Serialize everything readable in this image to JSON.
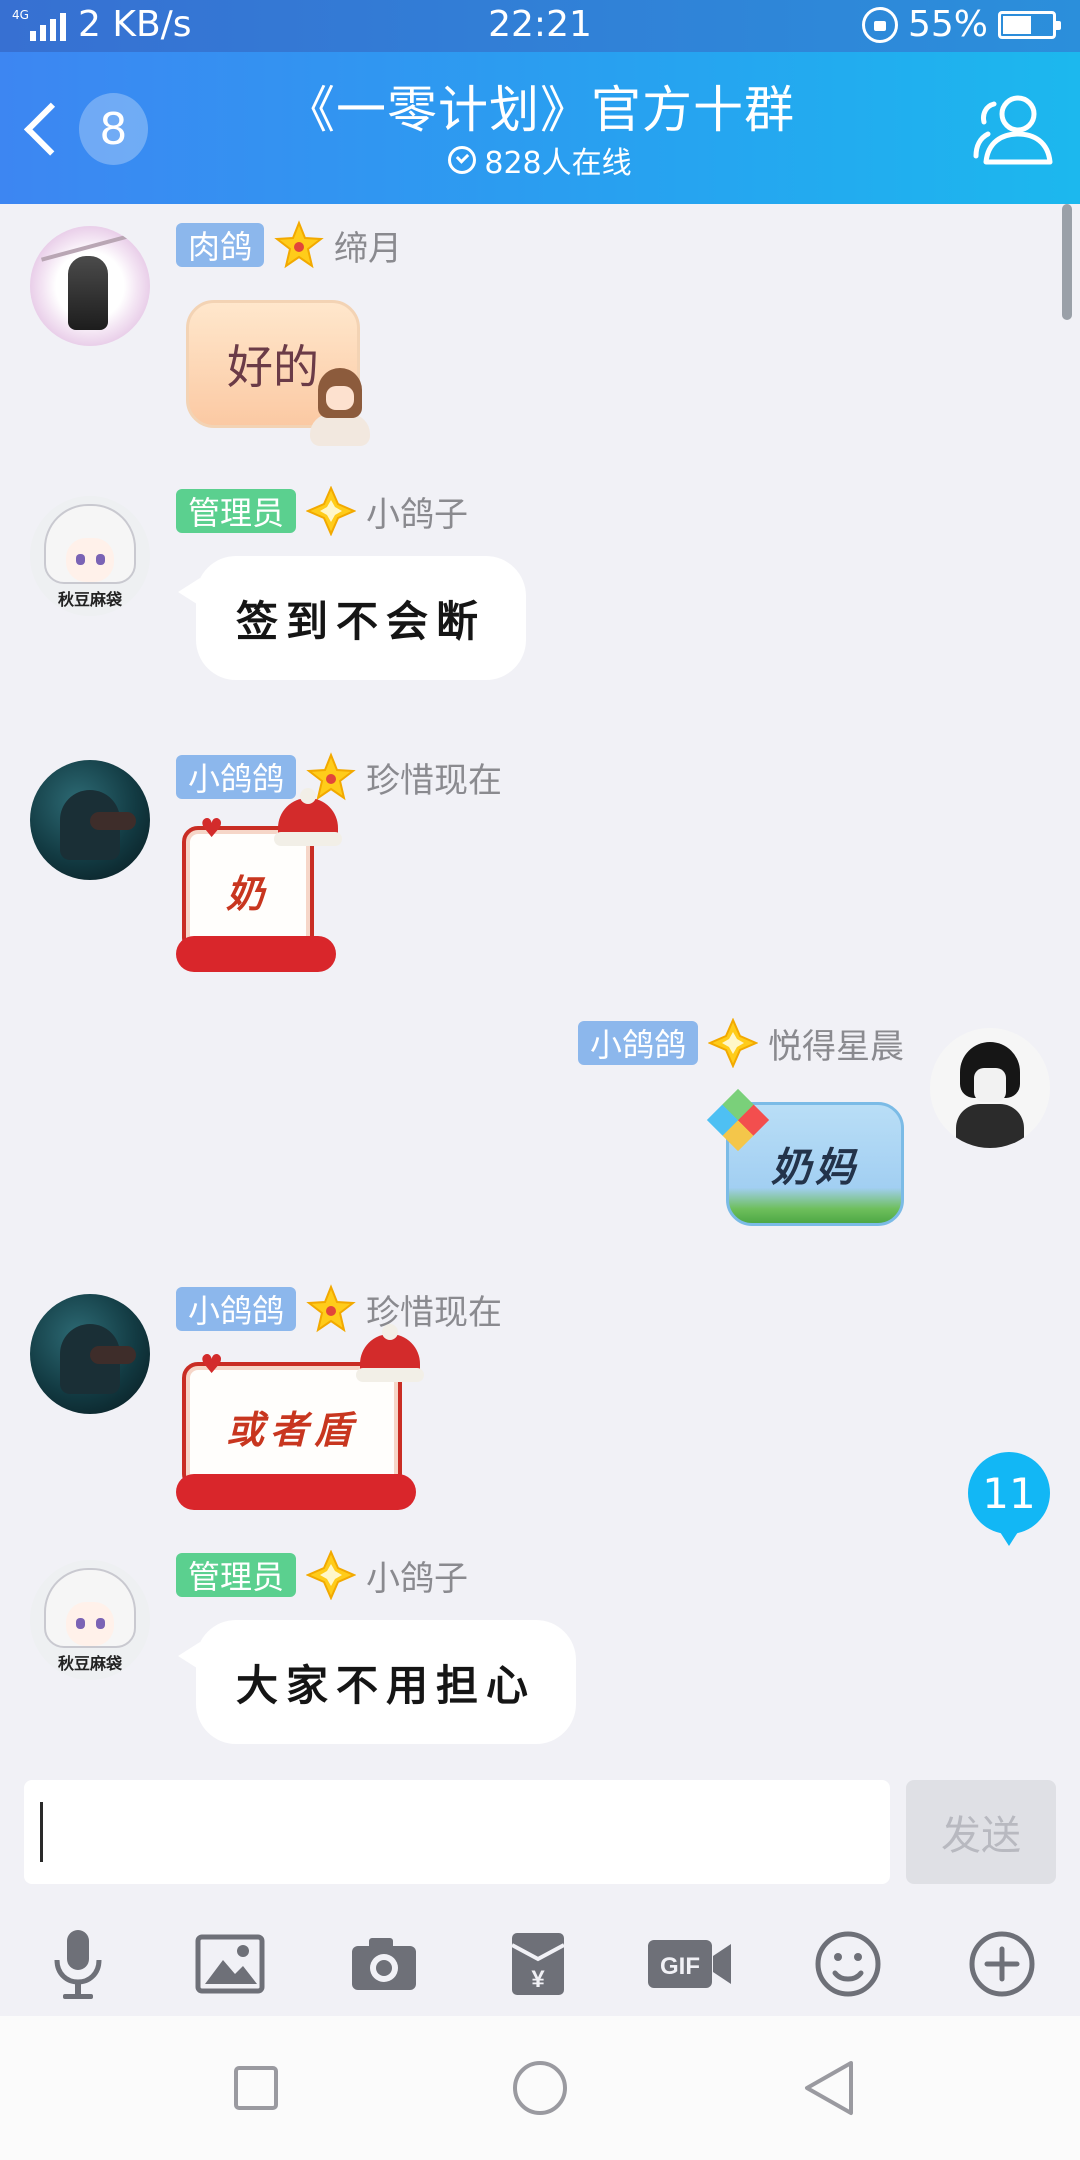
{
  "status_bar": {
    "network": "4G",
    "speed": "2 KB/s",
    "time": "22:21",
    "battery": "55%"
  },
  "header": {
    "back_badge": "8",
    "title": "《一零计划》官方十群",
    "online": "828人在线",
    "accent": "#27a2f0"
  },
  "messages": [
    {
      "side": "other",
      "avatar": "blossom-avatar",
      "role": "肉鸽",
      "role_color": "#8cb7ec",
      "star": "gold",
      "nick": "缔月",
      "text": "好的",
      "style": "peach"
    },
    {
      "side": "other",
      "avatar": "anime-avatar",
      "role": "管理员",
      "role_color": "#5bd08f",
      "star": "diamond",
      "nick": "小鸽子",
      "text": "签到不会断",
      "style": "plain",
      "avatar_tag": "秋豆麻袋"
    },
    {
      "side": "other",
      "avatar": "dark-avatar",
      "role": "小鸽鸽",
      "role_color": "#8cb7ec",
      "star": "gold",
      "nick": "珍惜现在",
      "text": "奶",
      "style": "xmas"
    },
    {
      "side": "mine",
      "avatar": "sketch-avatar",
      "role": "小鸽鸽",
      "role_color": "#8cb7ec",
      "star": "diamond",
      "nick": "悦得星晨",
      "text": "奶妈",
      "style": "sky"
    },
    {
      "side": "other",
      "avatar": "dark-avatar",
      "role": "小鸽鸽",
      "role_color": "#8cb7ec",
      "star": "gold",
      "nick": "珍惜现在",
      "text": "或者盾",
      "style": "xmas"
    },
    {
      "side": "other",
      "avatar": "anime-avatar",
      "role": "管理员",
      "role_color": "#5bd08f",
      "star": "diamond",
      "nick": "小鸽子",
      "text": "大家不用担心",
      "style": "plain",
      "avatar_tag": "秋豆麻袋"
    }
  ],
  "new_message_count": "11",
  "input": {
    "value": "",
    "placeholder": "",
    "send_label": "发送"
  },
  "toolbar": [
    "microphone-icon",
    "image-icon",
    "camera-icon",
    "red-packet-icon",
    "gif-icon",
    "emoji-icon",
    "plus-icon"
  ],
  "navbar": [
    "recent-apps-icon",
    "home-icon",
    "back-icon"
  ]
}
